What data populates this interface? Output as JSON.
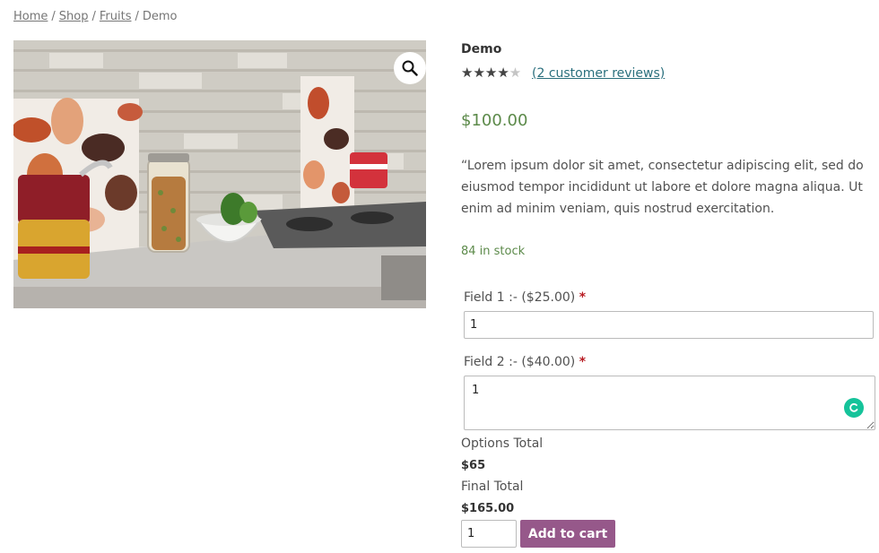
{
  "breadcrumb": {
    "home": "Home",
    "shop": "Shop",
    "category": "Fruits",
    "current": "Demo",
    "separator": "/"
  },
  "product": {
    "title": "Demo",
    "rating_fraction": 0.7,
    "stars_text": "★★★★★",
    "reviews_link": "(2 customer reviews)",
    "price": "$100.00",
    "description": "“Lorem ipsum dolor sit amet, consectetur adipiscing elit, sed do eiusmod tempor incididunt ut labore et dolore magna aliqua. Ut enim ad minim veniam, quis nostrud exercitation.",
    "stock": "84 in stock"
  },
  "fields": [
    {
      "label": "Field 1 :- ($25.00)",
      "required_mark": "*",
      "value": "1"
    },
    {
      "label": "Field 2 :- ($40.00)",
      "required_mark": "*",
      "value": "1"
    }
  ],
  "totals": {
    "options_label": "Options Total",
    "options_value": "$65",
    "final_label": "Final Total",
    "final_value": "$165.00"
  },
  "cart": {
    "quantity": "1",
    "add_label": "Add to cart"
  },
  "icons": {
    "zoom": "magnifier-icon",
    "grammar": "grammarly-icon"
  },
  "colors": {
    "price": "#5c8a4a",
    "button": "#96588a",
    "required": "#b81c23",
    "link": "#2a6f7d"
  }
}
